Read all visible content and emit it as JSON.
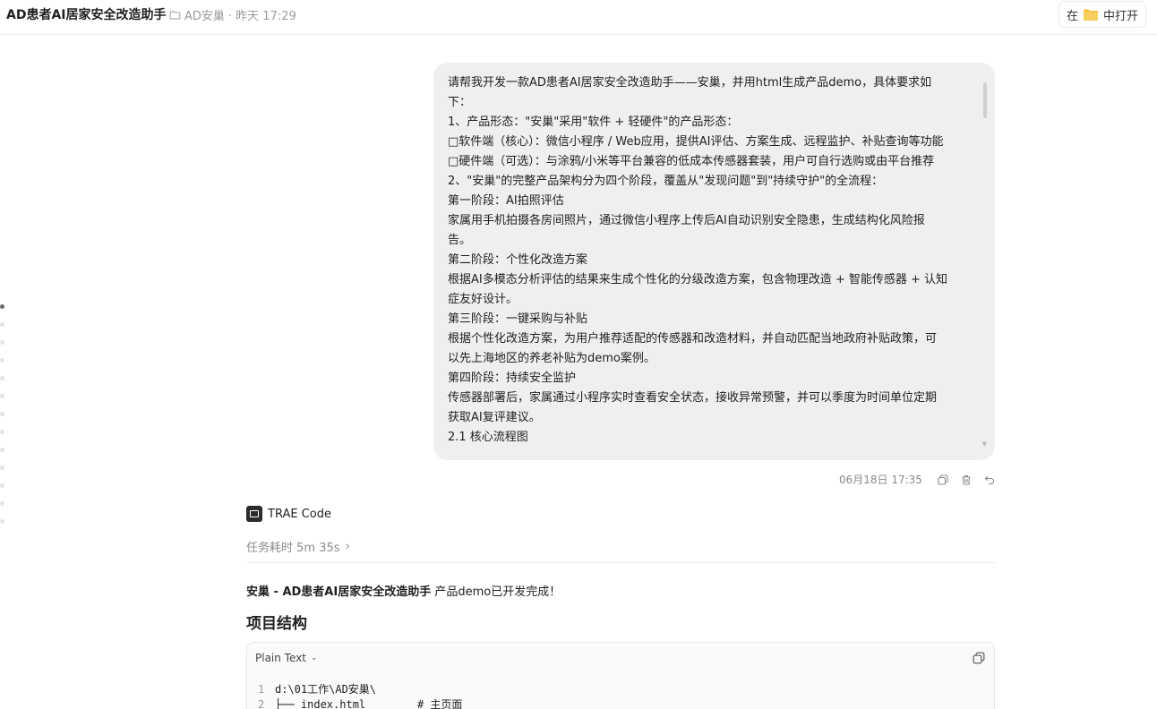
{
  "header": {
    "title": "AD患者AI居家安全改造助手",
    "folder_name": "AD安巢",
    "timestamp": "· 昨天 17:29",
    "open_in_prefix": "在",
    "open_in_suffix": "中打开"
  },
  "user_message": {
    "lines": [
      "请帮我开发一款AD患者AI居家安全改造助手——安巢，并用html生成产品demo，具体要求如",
      "下：",
      "1、产品形态：\"安巢\"采用\"软件 + 轻硬件\"的产品形态：",
      "□软件端（核心）：微信小程序 / Web应用，提供AI评估、方案生成、远程监护、补贴查询等功能",
      "□硬件端（可选）：与涂鸦/小米等平台兼容的低成本传感器套装，用户可自行选购或由平台推荐",
      "2、\"安巢\"的完整产品架构分为四个阶段，覆盖从\"发现问题\"到\"持续守护\"的全流程：",
      "第一阶段：AI拍照评估",
      "家属用手机拍摄各房间照片，通过微信小程序上传后AI自动识别安全隐患，生成结构化风险报",
      "告。",
      "第二阶段：个性化改造方案",
      "根据AI多模态分析评估的结果来生成个性化的分级改造方案，包含物理改造 + 智能传感器 + 认知",
      "症友好设计。",
      "第三阶段：一键采购与补贴",
      "根据个性化改造方案，为用户推荐适配的传感器和改造材料，并自动匹配当地政府补贴政策，可",
      "以先上海地区的养老补贴为demo案例。",
      "第四阶段：持续安全监护",
      "传感器部署后，家属通过小程序实时查看安全状态，接收异常预警，并可以季度为时间单位定期",
      "获取AI复评建议。",
      "2.1 核心流程图"
    ],
    "time": "06月18日 17:35"
  },
  "assistant": {
    "name": "TRAE Code",
    "task_time": "任务耗时 5m 35s",
    "done_bold": "安巢 - AD患者AI居家安全改造助手",
    "done_rest": " 产品demo已开发完成！",
    "section_title": "项目结构",
    "code": {
      "language": "Plain Text",
      "lines": [
        {
          "num": "1",
          "text": "d:\\01工作\\AD安巢\\"
        },
        {
          "num": "2",
          "text": "├── index.html        # 主页面"
        }
      ]
    }
  },
  "icons": {
    "folder": "folder-icon",
    "copy": "copy-icon",
    "delete": "trash-icon",
    "undo": "undo-icon",
    "chevron": "chevron-right-icon"
  },
  "colors": {
    "bubble_bg": "#efefef",
    "folder_yellow": "#f5c242",
    "muted_text": "#8a8a8a"
  }
}
